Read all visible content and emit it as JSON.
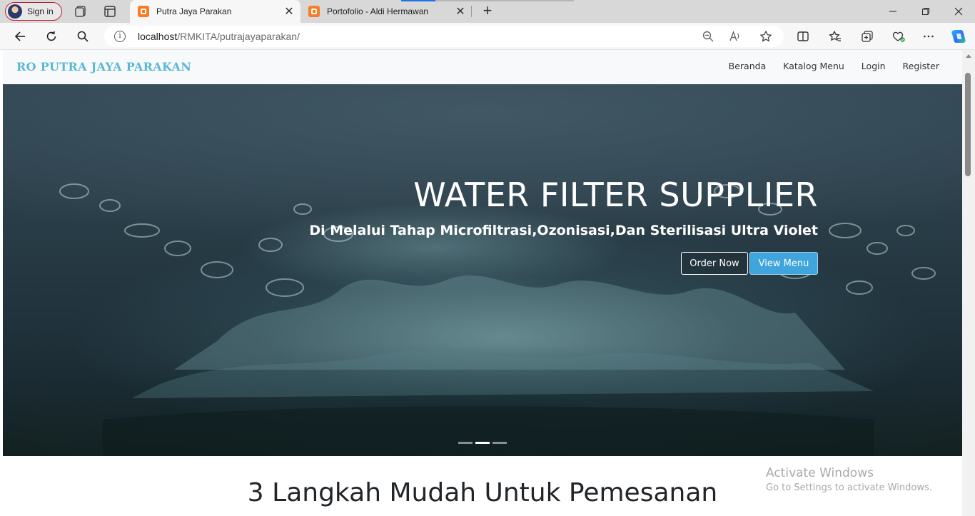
{
  "browser": {
    "signin_label": "Sign in",
    "tabs": [
      {
        "title": "Putra Jaya Parakan",
        "active": true
      },
      {
        "title": "Portofolio - Aldi Hermawan",
        "active": false
      }
    ],
    "address": {
      "host": "localhost",
      "path": "/RMKITA/putrajayaparakan/"
    },
    "accent": "#1a73e8"
  },
  "site": {
    "brand": "RO PUTRA JAYA PARAKAN",
    "brand_color": "#5ab8d6",
    "nav": [
      "Beranda",
      "Katalog Menu",
      "Login",
      "Register"
    ]
  },
  "hero": {
    "title": "WATER FILTER SUPPLIER",
    "subtitle": "Di Melalui Tahap Microfiltrasi,Ozonisasi,Dan Sterilisasi Ultra Violet",
    "order_button": "Order Now",
    "view_button": "View Menu",
    "view_button_color": "#41a5dd",
    "slides_count": 3,
    "active_slide": 2
  },
  "section": {
    "title": "3 Langkah Mudah Untuk Pemesanan"
  },
  "watermark": {
    "line1": "Activate Windows",
    "line2": "Go to Settings to activate Windows."
  }
}
